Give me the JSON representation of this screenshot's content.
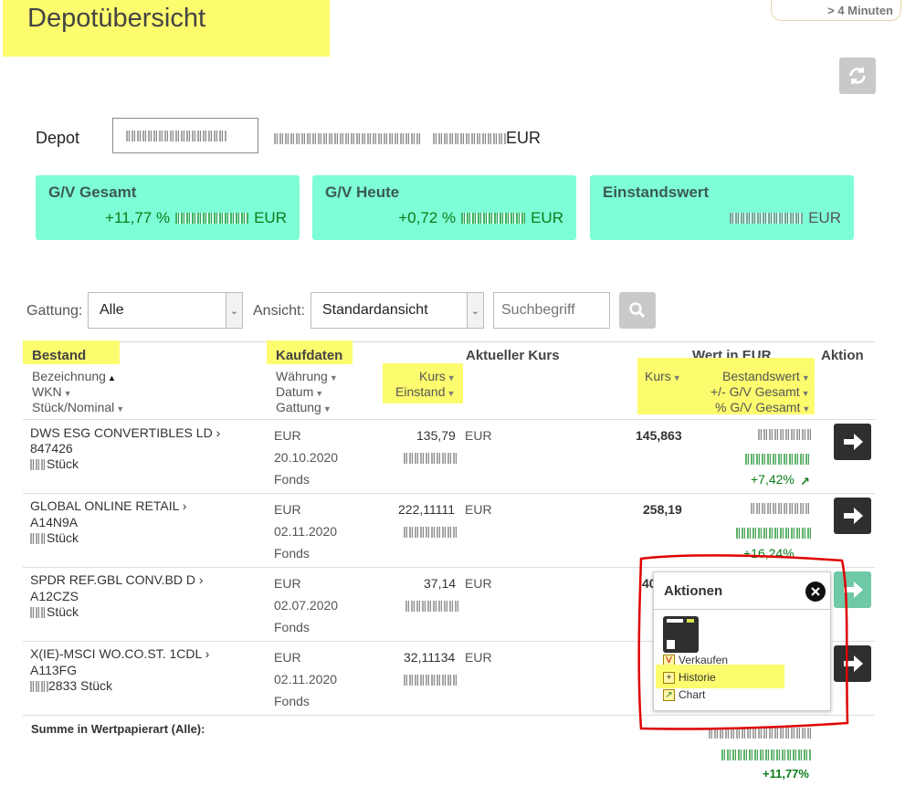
{
  "header": {
    "title": "Depotübersicht",
    "refresh_timer": "> 4 Minuten"
  },
  "depot": {
    "label": "Depot",
    "currency": "EUR"
  },
  "cards": [
    {
      "title": "G/V Gesamt",
      "percent": "+11,77 %",
      "currency": "EUR"
    },
    {
      "title": "G/V Heute",
      "percent": "+0,72 %",
      "currency": "EUR"
    },
    {
      "title": "Einstandswert",
      "percent": "",
      "currency": "EUR"
    }
  ],
  "filters": {
    "gattung_label": "Gattung:",
    "gattung_value": "Alle",
    "ansicht_label": "Ansicht:",
    "ansicht_value": "Standardansicht",
    "search_placeholder": "Suchbegriff"
  },
  "table": {
    "groups": {
      "bestand": "Bestand",
      "kaufdaten": "Kaufdaten",
      "aktueller_kurs": "Aktueller Kurs",
      "wert": "Wert in EUR",
      "aktion": "Aktion"
    },
    "sort": {
      "bezeichnung": "Bezeichnung",
      "wkn": "WKN",
      "stueck": "Stück/Nominal",
      "waehrung": "Währung",
      "datum": "Datum",
      "gattung": "Gattung",
      "kurs": "Kurs",
      "einstand": "Einstand",
      "kurs2": "Kurs",
      "bestandswert": "Bestandswert",
      "gv_gesamt": "+/- G/V Gesamt",
      "pct_gv": "% G/V Gesamt"
    },
    "rows": [
      {
        "name": "DWS ESG CONVERTIBLES LD",
        "wkn": "847426",
        "qty": "Stück",
        "currency": "EUR",
        "date": "20.10.2020",
        "type": "Fonds",
        "kurs": "135,79",
        "cur_currency": "EUR",
        "cur_price": "145,863",
        "pct": "+7,42%"
      },
      {
        "name": "GLOBAL ONLINE RETAIL",
        "wkn": "A14N9A",
        "qty": "Stück",
        "currency": "EUR",
        "date": "02.11.2020",
        "type": "Fonds",
        "kurs": "222,11111",
        "cur_currency": "EUR",
        "cur_price": "258,19",
        "pct": "+16,24%"
      },
      {
        "name": "SPDR REF.GBL CONV.BD D",
        "wkn": "A12CZS",
        "qty": "Stück",
        "currency": "EUR",
        "date": "02.07.2020",
        "type": "Fonds",
        "kurs": "37,14",
        "cur_currency": "EUR",
        "cur_price": "40",
        "pct": ""
      },
      {
        "name": "X(IE)-MSCI WO.CO.ST. 1CDL",
        "wkn": "A113FG",
        "qty": "2833 Stück",
        "currency": "EUR",
        "date": "02.11.2020",
        "type": "Fonds",
        "kurs": "32,11134",
        "cur_currency": "EUR",
        "cur_price": "",
        "pct": ""
      }
    ],
    "sum_label": "Summe in Wertpapierart (Alle):",
    "sum_pct": "+11,77%"
  },
  "popup": {
    "title": "Aktionen",
    "items": [
      "Verkaufen",
      "Historie",
      "Chart"
    ]
  },
  "colors": {
    "card_bg": "#7efed6",
    "highlight": "#fdfb6e",
    "gain": "#0a7d1a",
    "annotation": "#e00000"
  }
}
